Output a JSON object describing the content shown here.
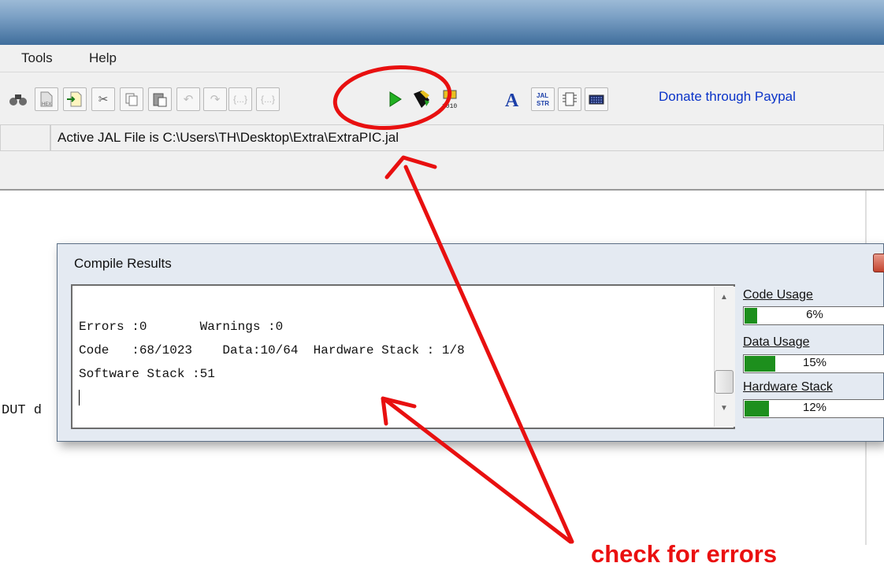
{
  "menu": {
    "tools": "Tools",
    "help": "Help"
  },
  "toolbar": {
    "buttons": [
      "binoculars-icon",
      "hex-file-icon",
      "import-icon",
      "cut-icon",
      "copy-icon",
      "paste-icon",
      "undo-icon",
      "redo-icon",
      "braces-icon",
      "braces-icon",
      "compile-icon",
      "program-chip-icon",
      "chip-io-icon",
      "font-a-icon",
      "jal-str-icon",
      "chip-config-icon",
      "keyboard-icon"
    ],
    "donate_label": "Donate through Paypal"
  },
  "status": {
    "active_file": "Active JAL File is C:\\Users\\TH\\Desktop\\Extra\\ExtraPIC.jal"
  },
  "editor": {
    "fragment_out": "DUT d"
  },
  "dialog": {
    "title": "Compile Results",
    "output_lines": [
      "Errors :0       Warnings :0",
      "Code   :68/1023    Data:10/64  Hardware Stack : 1/8",
      "Software Stack :51"
    ],
    "meters": [
      {
        "label": "Code Usage",
        "text": "6%",
        "fraction": 0.06
      },
      {
        "label": "Data Usage",
        "text": "15%",
        "fraction": 0.15
      },
      {
        "label": "Hardware Stack",
        "text": "12%",
        "fraction": 0.12
      }
    ]
  },
  "annotation": {
    "text": "check for errors",
    "color": "#ea1010"
  }
}
